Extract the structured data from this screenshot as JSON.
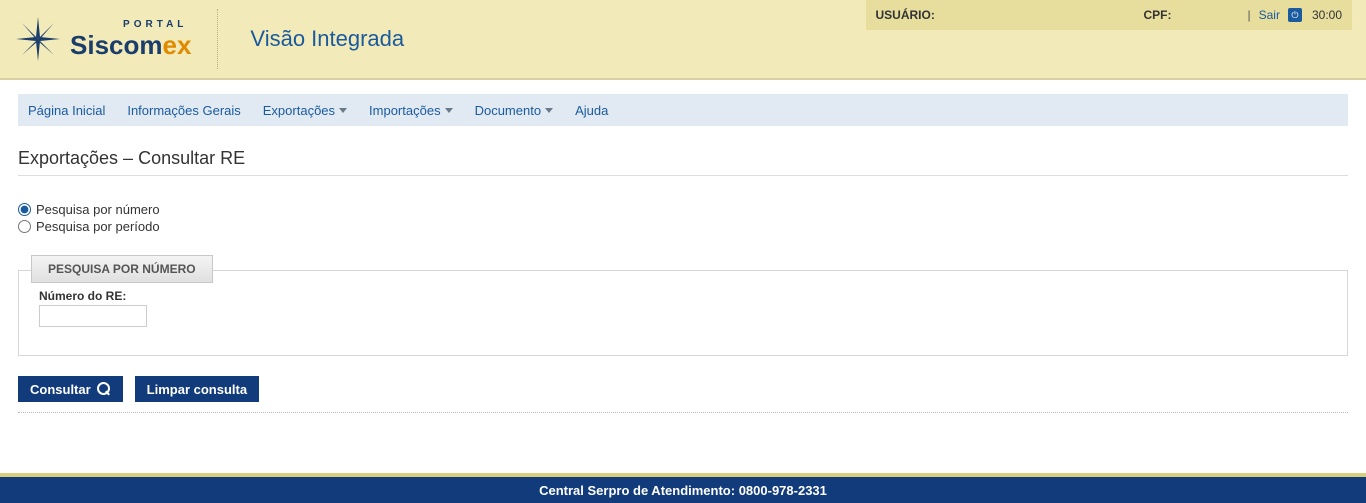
{
  "header": {
    "logo_top": "PORTAL",
    "logo_main_a": "Siscom",
    "logo_main_b": "ex",
    "app_title": "Visão Integrada",
    "user_label": "USUÁRIO:",
    "cpf_label": "CPF:",
    "sair_label": "Sair",
    "timer": "30:00"
  },
  "nav": {
    "items": [
      {
        "label": "Página Inicial",
        "dropdown": false
      },
      {
        "label": "Informações Gerais",
        "dropdown": false
      },
      {
        "label": "Exportações",
        "dropdown": true
      },
      {
        "label": "Importações",
        "dropdown": true
      },
      {
        "label": "Documento",
        "dropdown": true
      },
      {
        "label": "Ajuda",
        "dropdown": false
      }
    ]
  },
  "page": {
    "title": "Exportações – Consultar RE",
    "radio_numero": "Pesquisa por número",
    "radio_periodo": "Pesquisa por período",
    "fieldset_legend": "PESQUISA POR NÚMERO",
    "numero_label": "Número do RE:",
    "numero_value": ""
  },
  "buttons": {
    "consultar": "Consultar",
    "limpar": "Limpar consulta"
  },
  "footer": {
    "text": "Central Serpro de Atendimento: 0800-978-2331"
  }
}
